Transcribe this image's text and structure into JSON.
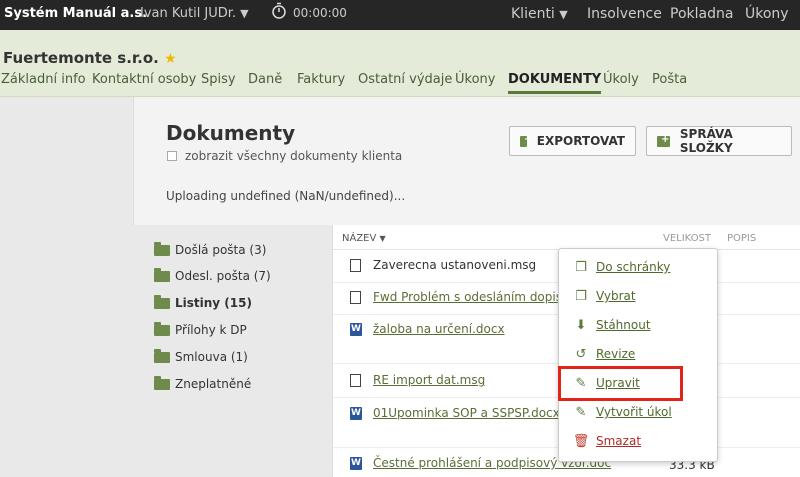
{
  "topbar": {
    "brand": "Systém Manuál a.s.",
    "user": "Ivan Kutil JUDr.",
    "timer": "00:00:00",
    "nav": [
      "Klienti",
      "Insolvence",
      "Pokladna",
      "Úkony"
    ]
  },
  "client": {
    "name": "Fuertemonte s.r.o.",
    "tabs": [
      "Základní info",
      "Kontaktní osoby",
      "Spisy",
      "Daně",
      "Faktury",
      "Ostatní výdaje",
      "Úkony",
      "DOKUMENTY",
      "Úkoly",
      "Pošta"
    ],
    "active_tab": "DOKUMENTY"
  },
  "panel": {
    "title": "Dokumenty",
    "checkbox_label": "zobrazit všechny dokumenty klienta",
    "upload_status": "Uploading undefined (NaN/undefined)...",
    "export_button": "EXPORTOVAT",
    "folder_mgmt_button": "SPRÁVA SLOŽKY"
  },
  "folders": [
    {
      "label": "Došlá pošta (3)"
    },
    {
      "label": "Odesl. pošta (7)"
    },
    {
      "label": "Listiny (15)"
    },
    {
      "label": "Přílohy k DP"
    },
    {
      "label": "Smlouva (1)"
    },
    {
      "label": "Zneplatněné"
    }
  ],
  "files_header": {
    "name": "NÁZEV",
    "size": "VELIKOST",
    "desc": "POPIS"
  },
  "files": [
    {
      "name": "Zaverecna ustanoveni.msg",
      "icon": "document-icon",
      "size": ""
    },
    {
      "name": "Fwd Problém s odesláním dopisu",
      "icon": "document-icon",
      "size": ""
    },
    {
      "name": "žaloba na určení.docx",
      "icon": "word-icon",
      "size": ""
    },
    {
      "name": "RE import dat.msg",
      "icon": "document-icon",
      "size": ""
    },
    {
      "name": "01Upominka SOP a SSPSP.docx",
      "icon": "word-icon",
      "size": ""
    },
    {
      "name": "Čestné prohlášení a podpisový vzor.doc",
      "icon": "word-icon",
      "size": "33.3 kB"
    }
  ],
  "context_menu": [
    {
      "label": "Do schránky",
      "icon": "copy-icon"
    },
    {
      "label": "Vybrat",
      "icon": "copy-icon"
    },
    {
      "label": "Stáhnout",
      "icon": "download-icon"
    },
    {
      "label": "Revize",
      "icon": "history-icon"
    },
    {
      "label": "Upravit",
      "icon": "pencil-icon"
    },
    {
      "label": "Vytvořit úkol",
      "icon": "pencil-icon"
    },
    {
      "label": "Smazat",
      "icon": "trash-icon"
    }
  ],
  "colors": {
    "accent": "#5a7a3c",
    "highlight": "#e2231a",
    "danger": "#b12a2a"
  }
}
